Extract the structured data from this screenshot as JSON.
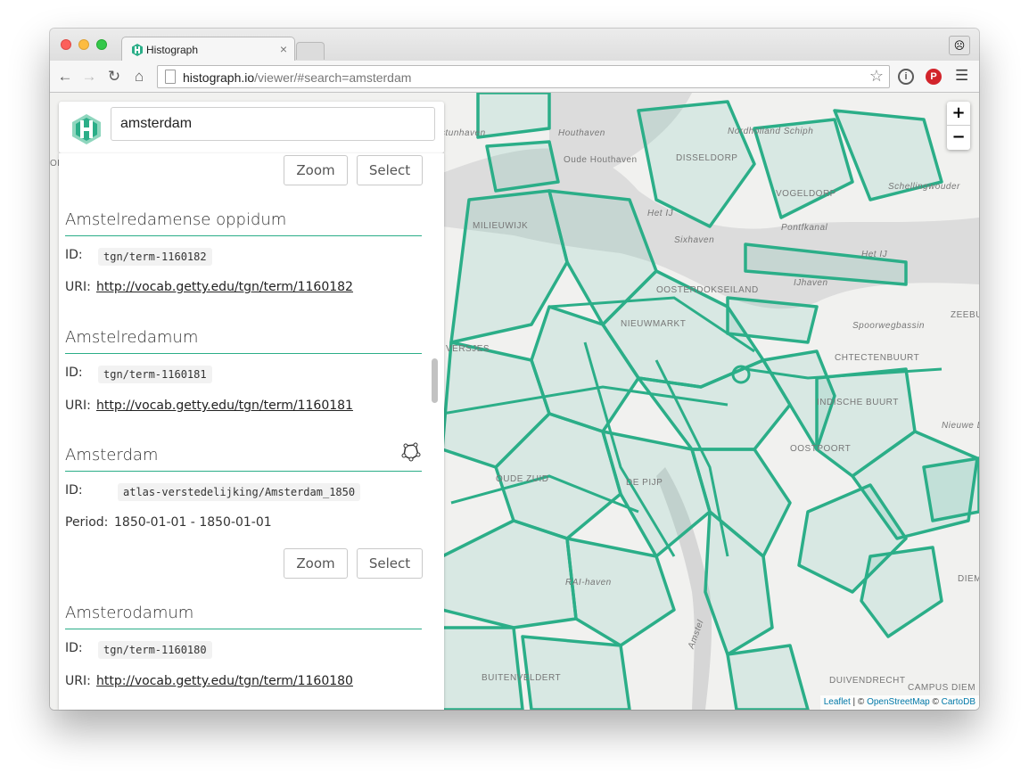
{
  "browser": {
    "tab_title": "Histograph",
    "tab_close": "×",
    "url_host": "histograph.io",
    "url_path": "/viewer/#search=amsterdam",
    "colors": {
      "accent": "#2bae88",
      "pinterest": "#d2242b"
    }
  },
  "search": {
    "value": "amsterdam"
  },
  "top_actions": {
    "zoom_label": "Zoom",
    "select_label": "Select"
  },
  "results": [
    {
      "title": "Amstelredamense oppidum",
      "id_label": "ID:",
      "id": "tgn/term-1160182",
      "uri_label": "URI:",
      "uri": "http://vocab.getty.edu/tgn/term/1160182"
    },
    {
      "title": "Amstelredamum",
      "id_label": "ID:",
      "id": "tgn/term-1160181",
      "uri_label": "URI:",
      "uri": "http://vocab.getty.edu/tgn/term/1160181"
    },
    {
      "title": "Amsterdam",
      "id_label": "ID:",
      "id": "atlas-verstedelijking/Amsterdam_1850",
      "period_label": "Period:",
      "period": "1850-01-01 - 1850-01-01",
      "zoom_label": "Zoom",
      "select_label": "Select",
      "geometry_icon": "polygon-icon"
    },
    {
      "title": "Amsterodamum",
      "id_label": "ID:",
      "id": "tgn/term-1160180",
      "uri_label": "URI:",
      "uri": "http://vocab.getty.edu/tgn/term/1160180"
    }
  ],
  "map": {
    "zoom_in": "+",
    "zoom_out": "−",
    "attribution": {
      "leaflet": "Leaflet",
      "sep1": " | © ",
      "osm": "OpenStreetMap",
      "sep2": " © ",
      "carto": "CartoDB"
    },
    "labels": [
      "Houthaven",
      "Oude Houthaven",
      "DISSELDORP",
      "Nordholland Schiph",
      "VOGELDORP",
      "Het IJ",
      "Pontfkanal",
      "Sixhaven",
      "Het IJ",
      "IJhaven",
      "OOSTERDOKSEILAND",
      "NIEUWMARKT",
      "Spoorwegbassin",
      "ZEEBU",
      "CHTECTENBUURT",
      "OUDE ZUID",
      "DE PIJP",
      "OOSTPOORT",
      "INDISCHE BUURT",
      "Nieuwe D",
      "RAI-haven",
      "Amstel",
      "BUITENVELDERT",
      "DUIVENDRECHT",
      "CAMPUS DIEM",
      "DIEM",
      "MILIEUWIJK",
      "VERSJES",
      "ORTNES",
      "stunhaven",
      "Schellingwouder"
    ]
  }
}
